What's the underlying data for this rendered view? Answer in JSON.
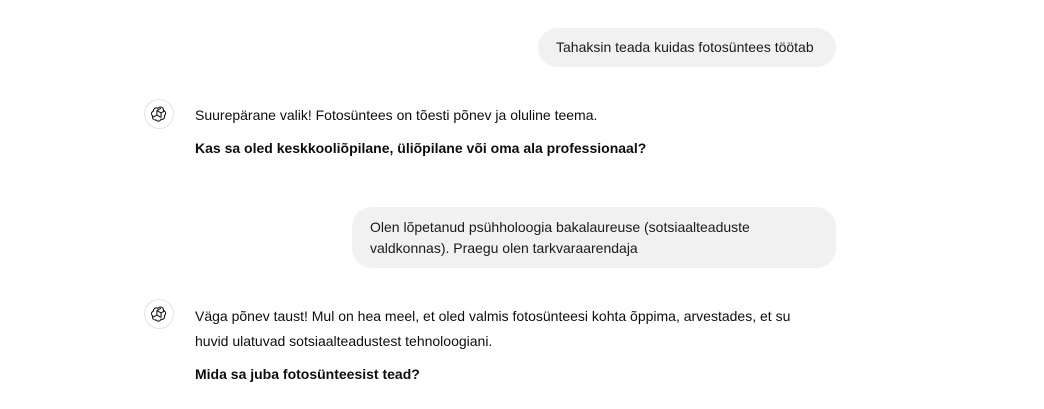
{
  "conversation": {
    "messages": [
      {
        "role": "user",
        "text": "Tahaksin teada kuidas fotosüntees töötab"
      },
      {
        "role": "assistant",
        "avatar_icon": "openai-logo-icon",
        "paragraphs": [
          "Suurepärane valik! Fotosüntees on tõesti põnev ja oluline teema.",
          "Kas sa oled keskkooliõpilane, üliõpilane või oma ala professionaal?"
        ]
      },
      {
        "role": "user",
        "text": "Olen lõpetanud psühholoogia bakalaureuse (sotsiaalteaduste valdkonnas). Praegu olen tarkvaraarendaja"
      },
      {
        "role": "assistant",
        "avatar_icon": "openai-logo-icon",
        "paragraphs": [
          "Väga põnev taust! Mul on hea meel, et oled valmis fotosünteesi kohta õppima, arvestades, et su huvid ulatuvad sotsiaalteadustest tehnoloogiani.",
          "Mida sa juba fotosünteesist tead?"
        ]
      }
    ]
  },
  "colors": {
    "user_bubble_bg": "#f1f1f1",
    "text": "#0d0d0d",
    "avatar_border": "#e3e3e3"
  }
}
